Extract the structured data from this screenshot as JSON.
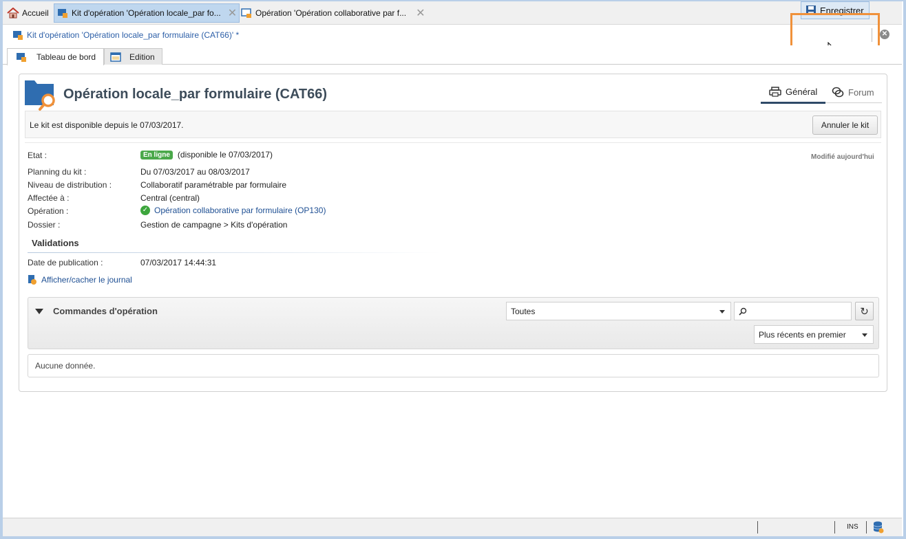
{
  "tabs": [
    {
      "label": "Accueil"
    },
    {
      "label": "Kit d'opération 'Opération locale_par fo..."
    },
    {
      "label": "Opération 'Opération collaborative par f..."
    }
  ],
  "breadcrumb": "Kit d'opération 'Opération locale_par formulaire (CAT66)' *",
  "toolbar": {
    "save_label": "Enregistrer"
  },
  "view_tabs": [
    {
      "label": "Tableau de bord"
    },
    {
      "label": "Edition"
    }
  ],
  "main": {
    "title": "Opération locale_par formulaire (CAT66)",
    "right_tabs": [
      {
        "label": "Général"
      },
      {
        "label": "Forum"
      }
    ],
    "info_text": "Le kit est disponible depuis le 07/03/2017.",
    "cancel_label": "Annuler le kit",
    "modified": "Modifié aujourd'hui",
    "fields": {
      "etat_label": "Etat :",
      "etat_badge": "En ligne",
      "etat_value": "(disponible le 07/03/2017)",
      "planning_label": "Planning du kit :",
      "planning_value": "Du 07/03/2017 au 08/03/2017",
      "niveau_label": "Niveau de distribution :",
      "niveau_value": "Collaboratif paramétrable par formulaire",
      "affectee_label": "Affectée à :",
      "affectee_value": "Central (central)",
      "operation_label": "Opération :",
      "operation_value": "Opération collaborative par formulaire (OP130)",
      "dossier_label": "Dossier :",
      "dossier_value": "Gestion de campagne > Kits d'opération"
    },
    "validations": {
      "heading": "Validations",
      "pub_label": "Date de publication :",
      "pub_value": "07/03/2017 14:44:31"
    },
    "journal_link": "Afficher/cacher le journal",
    "commands": {
      "title": "Commandes d'opération",
      "filter_value": "Toutes",
      "search_value": "",
      "sort_value": "Plus récents en premier",
      "empty_text": "Aucune donnée."
    }
  },
  "statusbar": {
    "mode": "INS"
  },
  "colors": {
    "accent": "#f0913a",
    "link": "#1e4f93",
    "badge": "#4aa84a"
  }
}
